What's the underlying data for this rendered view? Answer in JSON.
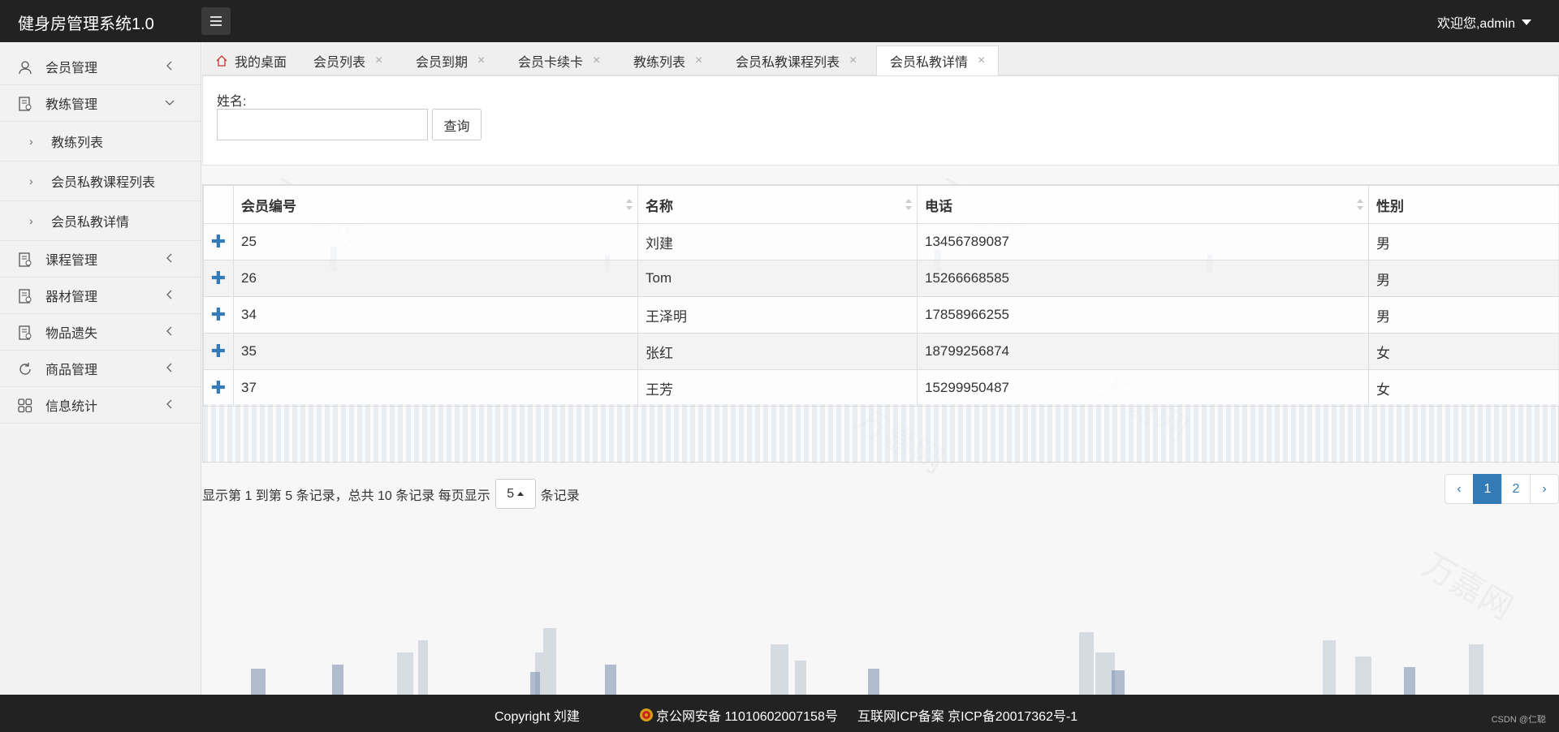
{
  "app": {
    "title": "健身房管理系统1.0",
    "user_greeting": "欢迎您,admin"
  },
  "sidebar": {
    "items": [
      {
        "label": "会员管理"
      },
      {
        "label": "教练管理"
      },
      {
        "label": "课程管理"
      },
      {
        "label": "器材管理"
      },
      {
        "label": "物品遗失"
      },
      {
        "label": "商品管理"
      },
      {
        "label": "信息统计"
      }
    ],
    "subitems": [
      {
        "label": "教练列表"
      },
      {
        "label": "会员私教课程列表"
      },
      {
        "label": "会员私教详情"
      }
    ]
  },
  "tabs": [
    {
      "label": "我的桌面"
    },
    {
      "label": "会员列表"
    },
    {
      "label": "会员到期"
    },
    {
      "label": "会员卡续卡"
    },
    {
      "label": "教练列表"
    },
    {
      "label": "会员私教课程列表"
    },
    {
      "label": "会员私教详情"
    }
  ],
  "search": {
    "label": "姓名:",
    "value": "",
    "button": "查询"
  },
  "table": {
    "columns": [
      "会员编号",
      "名称",
      "电话",
      "性别"
    ],
    "rows": [
      [
        "25",
        "刘建",
        "13456789087",
        "男"
      ],
      [
        "26",
        "Tom",
        "15266668585",
        "男"
      ],
      [
        "34",
        "王泽明",
        "17858966255",
        "男"
      ],
      [
        "35",
        "张红",
        "18799256874",
        "女"
      ],
      [
        "37",
        "王芳",
        "15299950487",
        "女"
      ]
    ]
  },
  "pagination": {
    "info_prefix": "显示第 1 到第 5 条记录，总共 10 条记录 每页显示",
    "page_size": "5",
    "info_suffix": "条记录",
    "prev": "‹",
    "pages": [
      "1",
      "2"
    ],
    "next": "›"
  },
  "footer": {
    "copyright": "Copyright 刘建",
    "police": "京公网安备 11010602007158号",
    "icp": "互联网ICP备案 京ICP备20017362号-1",
    "watermark": "CSDN @仁聪"
  },
  "colors": {
    "accent": "#337ab7",
    "topbar": "#222222"
  }
}
